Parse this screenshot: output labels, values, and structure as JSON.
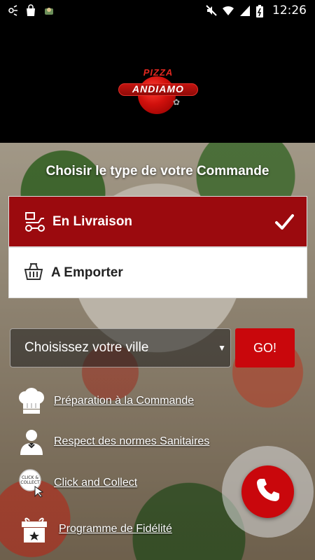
{
  "status_bar": {
    "time": "12:26",
    "left_icons": [
      "hotspot-icon",
      "shopping-bag-icon",
      "app-icon"
    ],
    "right_icons": [
      "mute-icon",
      "wifi-icon",
      "signal-icon",
      "battery-icon"
    ]
  },
  "brand": {
    "logo_top": "PIZZA",
    "logo_name": "ANDIAMO",
    "accent_color": "#9b0a0e",
    "button_color": "#c9070c"
  },
  "order": {
    "title": "Choisir le type de votre Commande",
    "options": [
      {
        "label": "En Livraison",
        "icon": "delivery-scooter-icon",
        "selected": true
      },
      {
        "label": "A Emporter",
        "icon": "basket-icon",
        "selected": false
      }
    ]
  },
  "city": {
    "selected": "Choisissez votre ville",
    "go_label": "GO!"
  },
  "features": [
    {
      "label": "Préparation à la Commande",
      "icon": "chef-hat-icon"
    },
    {
      "label": "Respect des normes Sanitaires",
      "icon": "waiter-icon"
    },
    {
      "label": "Click and Collect",
      "icon": "click-collect-icon"
    },
    {
      "label": "Programme de Fidélité",
      "icon": "gift-icon"
    }
  ],
  "call_button": {
    "icon": "phone-icon"
  }
}
